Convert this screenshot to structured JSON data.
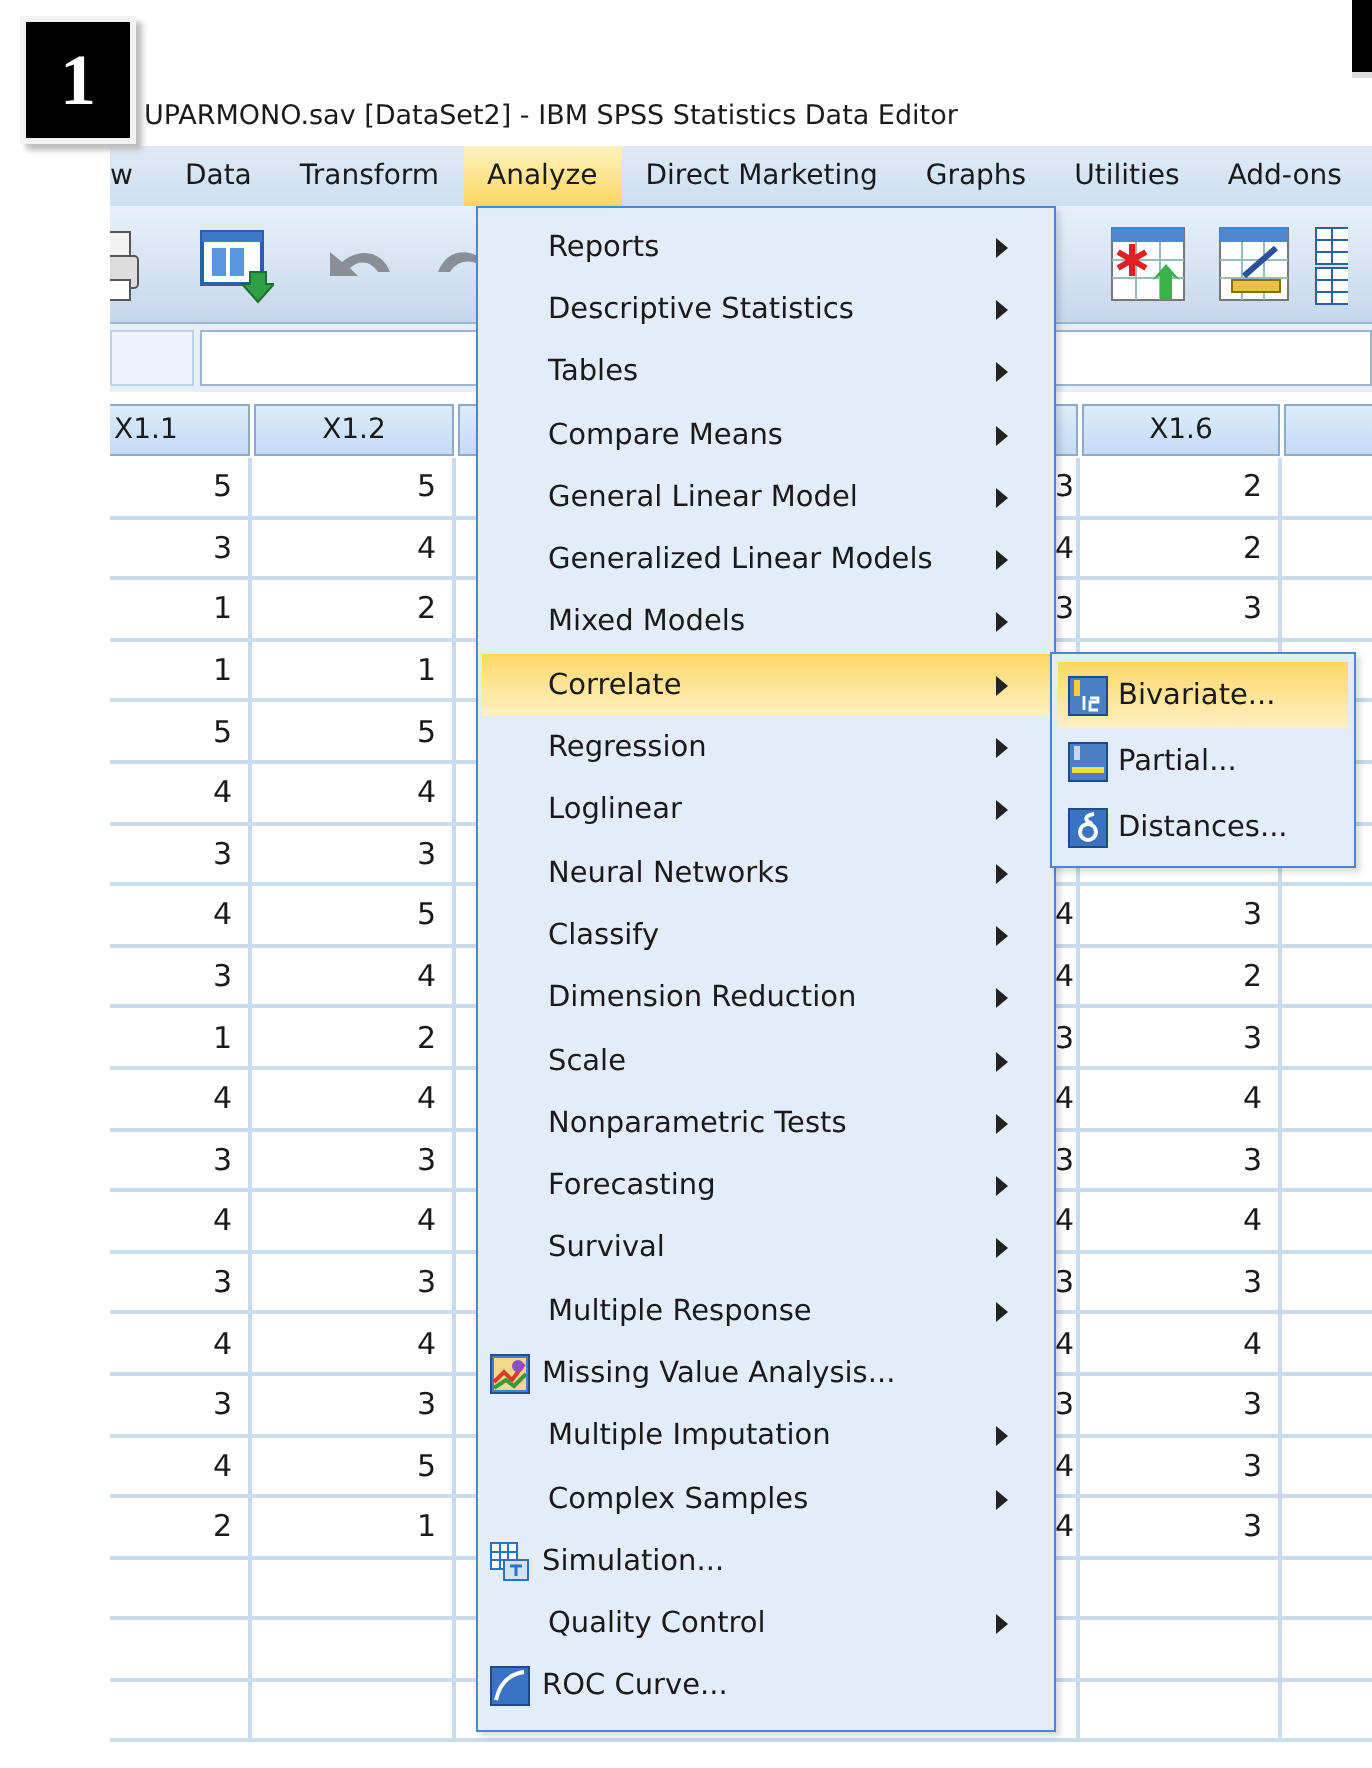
{
  "badge": "1",
  "window": {
    "title": "UPARMONO.sav [DataSet2] - IBM SPSS Statistics Data Editor"
  },
  "menu_bar": [
    {
      "label": "w",
      "selected": false
    },
    {
      "label": "Data",
      "selected": false
    },
    {
      "label": "Transform",
      "selected": false
    },
    {
      "label": "Analyze",
      "selected": true
    },
    {
      "label": "Direct Marketing",
      "selected": false
    },
    {
      "label": "Graphs",
      "selected": false
    },
    {
      "label": "Utilities",
      "selected": false
    },
    {
      "label": "Add-ons",
      "selected": false
    }
  ],
  "table": {
    "columns": [
      {
        "label": "X1.1",
        "cells": [
          "5",
          "3",
          "1",
          "1",
          "5",
          "4",
          "3",
          "4",
          "3",
          "1",
          "4",
          "3",
          "4",
          "3",
          "4",
          "3",
          "4",
          "2"
        ]
      },
      {
        "label": "X1.2",
        "cells": [
          "5",
          "4",
          "2",
          "1",
          "5",
          "4",
          "3",
          "5",
          "4",
          "2",
          "4",
          "3",
          "4",
          "3",
          "4",
          "3",
          "5",
          "1"
        ]
      },
      {
        "cells": [
          "3",
          "4",
          "3",
          null,
          null,
          null,
          null,
          "4",
          "4",
          "3",
          "4",
          "3",
          "4",
          "3",
          "4",
          "3",
          "4",
          "4"
        ]
      },
      {
        "label": "X1.6",
        "cells": [
          "2",
          "2",
          "3",
          null,
          null,
          null,
          null,
          "3",
          "2",
          "3",
          "4",
          "3",
          "4",
          "3",
          "4",
          "3",
          "3",
          "3"
        ]
      }
    ]
  },
  "analyze_menu": {
    "items": [
      {
        "label": "Reports",
        "kind": "submenu",
        "selected": false
      },
      {
        "label": "Descriptive Statistics",
        "kind": "submenu",
        "selected": false
      },
      {
        "label": "Tables",
        "kind": "submenu",
        "selected": false
      },
      {
        "label": "Compare Means",
        "kind": "submenu",
        "selected": false
      },
      {
        "label": "General Linear Model",
        "kind": "submenu",
        "selected": false
      },
      {
        "label": "Generalized Linear Models",
        "kind": "submenu",
        "selected": false
      },
      {
        "label": "Mixed Models",
        "kind": "submenu",
        "selected": false
      },
      {
        "label": "Correlate",
        "kind": "submenu",
        "selected": true
      },
      {
        "label": "Regression",
        "kind": "submenu",
        "selected": false
      },
      {
        "label": "Loglinear",
        "kind": "submenu",
        "selected": false
      },
      {
        "label": "Neural Networks",
        "kind": "submenu",
        "selected": false
      },
      {
        "label": "Classify",
        "kind": "submenu",
        "selected": false
      },
      {
        "label": "Dimension Reduction",
        "kind": "submenu",
        "selected": false
      },
      {
        "label": "Scale",
        "kind": "submenu",
        "selected": false
      },
      {
        "label": "Nonparametric Tests",
        "kind": "submenu",
        "selected": false
      },
      {
        "label": "Forecasting",
        "kind": "submenu",
        "selected": false
      },
      {
        "label": "Survival",
        "kind": "submenu",
        "selected": false
      },
      {
        "label": "Multiple Response",
        "kind": "submenu",
        "selected": false
      },
      {
        "label": "Missing Value Analysis...",
        "kind": "chartdialog",
        "selected": false
      },
      {
        "label": "Multiple Imputation",
        "kind": "submenu",
        "selected": false
      },
      {
        "label": "Complex Samples",
        "kind": "submenu",
        "selected": false
      },
      {
        "label": "Simulation...",
        "kind": "griddialog",
        "selected": false
      },
      {
        "label": "Quality Control",
        "kind": "submenu",
        "selected": false
      },
      {
        "label": "ROC Curve...",
        "kind": "curvedialog",
        "selected": false
      }
    ]
  },
  "correlate_submenu": {
    "items": [
      {
        "label": "Bivariate...",
        "kind": "bivariate",
        "selected": true
      },
      {
        "label": "Partial...",
        "kind": "partial",
        "selected": false
      },
      {
        "label": "Distances...",
        "kind": "distances",
        "selected": false
      }
    ]
  }
}
